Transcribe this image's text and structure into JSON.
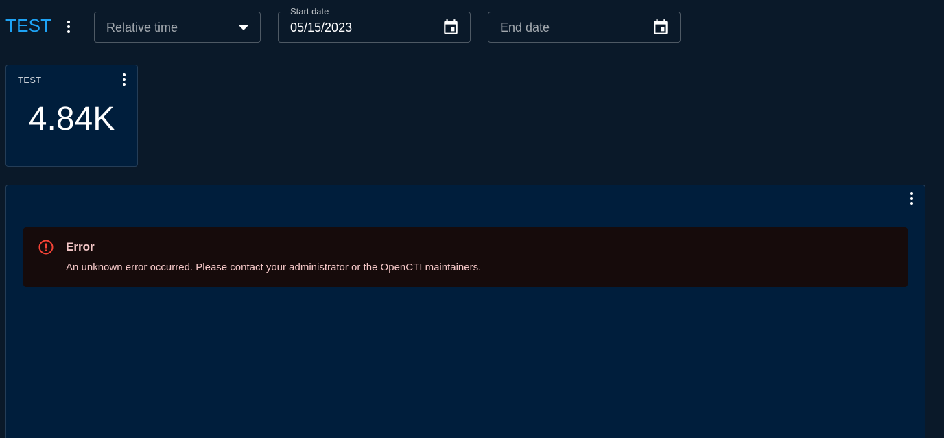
{
  "dashboard": {
    "title": "TEST"
  },
  "filters": {
    "relative_time": {
      "placeholder": "Relative time",
      "icon": "arrow-drop-down-icon"
    },
    "start_date": {
      "label": "Start date",
      "value": "05/15/2023",
      "icon": "calendar-icon"
    },
    "end_date": {
      "placeholder": "End date",
      "value": "",
      "icon": "calendar-icon"
    }
  },
  "widgets": [
    {
      "title": "TEST",
      "value": "4.84K"
    },
    {
      "title": "",
      "error": {
        "title": "Error",
        "message": "An unknown error occurred. Please contact your administrator or the OpenCTI maintainers.",
        "icon": "error-outline-icon"
      }
    }
  ],
  "colors": {
    "background": "#0a1929",
    "card": "#001e3c",
    "accent": "#1ea3f5",
    "error_bg": "#160b0b",
    "error_text": "#f4c7c7",
    "error_icon": "#f44336"
  }
}
